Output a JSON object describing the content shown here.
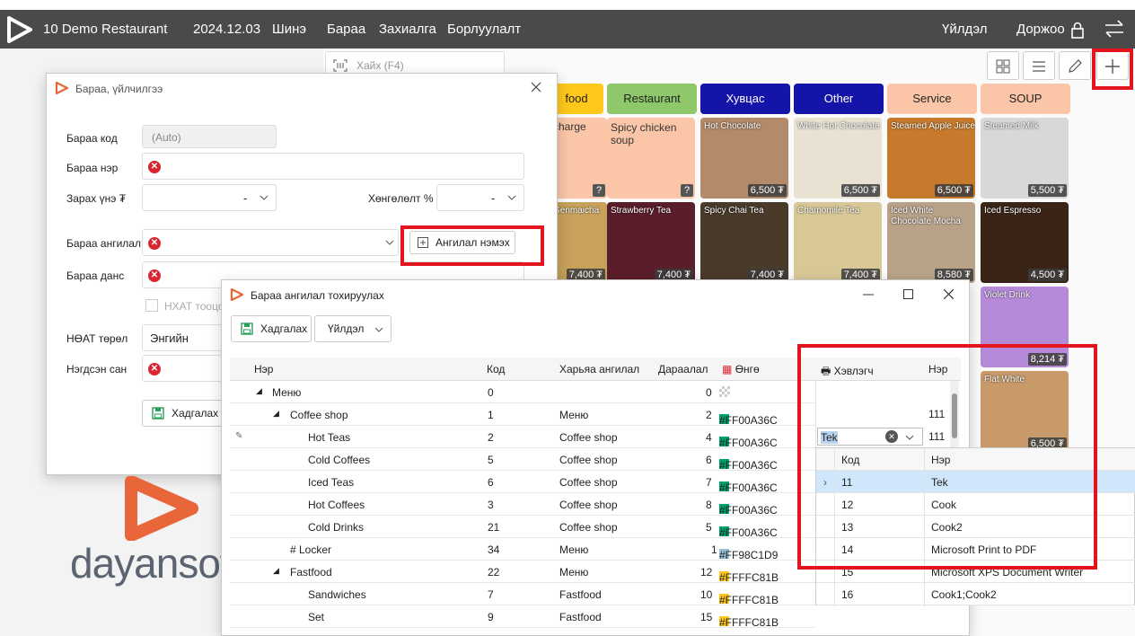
{
  "nav": {
    "restaurant": "10 Demo Restaurant",
    "date": "2024.12.03",
    "items": [
      "Шинэ",
      "Бараа",
      "Захиалга",
      "Борлуулалт"
    ],
    "action": "Үйлдэл",
    "user": "Доржоо"
  },
  "search": {
    "placeholder": "Хайх (F4)"
  },
  "categories": [
    {
      "label": "food",
      "color": "#FFC81B"
    },
    {
      "label": "Restaurant",
      "color": "#8FC86A"
    },
    {
      "label": "Хувцас",
      "color": "#1414A8"
    },
    {
      "label": "Other",
      "color": "#1414A8"
    },
    {
      "label": "Service",
      "color": "#FBC6A8"
    },
    {
      "label": "SOUP",
      "color": "#FBC6A8"
    }
  ],
  "tiles": [
    {
      "name": "charge",
      "price": "",
      "bg": "#FBC6A8"
    },
    {
      "name": "Spicy chicken soup",
      "price": "",
      "bg": "#FBC6A8"
    },
    {
      "name": "Hot Chocolate",
      "price": "6,500 ₮",
      "bg": "#b38a6a"
    },
    {
      "name": "White Hot Chocolate",
      "price": "6,500 ₮",
      "bg": "#e9e2d3"
    },
    {
      "name": "Steamed Apple Juice",
      "price": "6,500 ₮",
      "bg": "#c77a2b"
    },
    {
      "name": "Steamed Milk",
      "price": "5,500 ₮",
      "bg": "#e8e8e8"
    },
    {
      "name": "Genmaicha",
      "price": "7,400 ₮",
      "bg": "#c8a25a"
    },
    {
      "name": "Strawberry Tea",
      "price": "7,400 ₮",
      "bg": "#5a1d2a"
    },
    {
      "name": "Spicy Chai Tea",
      "price": "7,400 ₮",
      "bg": "#4a3a2a"
    },
    {
      "name": "Chamomile Tea",
      "price": "7,400 ₮",
      "bg": "#d8c898"
    },
    {
      "name": "Iced White Chocolate Mocha",
      "price": "8,580 ₮",
      "bg": "#d8c2a8"
    },
    {
      "name": "Iced Espresso",
      "price": "4,500 ₮",
      "bg": "#3a2418"
    },
    {
      "name": "Violet Drink",
      "price": "8,214 ₮",
      "bg": "#b58ad8"
    },
    {
      "name": "Flat White",
      "price": "6,500 ₮",
      "bg": "#c89a6a"
    }
  ],
  "win1": {
    "title": "Бараа, үйлчилгээ",
    "code_label": "Бараа код",
    "code_value": "(Auto)",
    "name_label": "Бараа нэр",
    "price_label": "Зарах үнэ ₮",
    "price_value": "-",
    "discount_label": "Хөнгөлөлт %",
    "discount_value": "-",
    "category_label": "Бараа ангилал",
    "add_category": "Ангилал нэмэх",
    "account_label": "Бараа данс",
    "vat_checkbox": "НХАТ тооцох",
    "vat_type_label": "НӨАТ төрөл",
    "vat_type_value": "Энгийн",
    "unit_label": "Нэгдсэн сан",
    "save": "Хадгалах"
  },
  "brand": "dayansoft",
  "win2": {
    "title": "Бараа ангилал тохируулах",
    "save": "Хадгалах",
    "action": "Үйлдэл",
    "columns": [
      "Нэр",
      "Код",
      "Харьяа ангилал",
      "Дараалал",
      "Өнгө",
      "Хэвлэгч",
      "Нэр"
    ],
    "rows": [
      {
        "name": "Меню",
        "code": "0",
        "parent": "",
        "order": "0",
        "color": "",
        "printer": "",
        "last": "",
        "indent": 0
      },
      {
        "name": "Coffee shop",
        "code": "1",
        "parent": "Меню",
        "order": "2",
        "color": "#FF00A36C",
        "printer": "",
        "last": "111",
        "indent": 1
      },
      {
        "name": "Hot Teas",
        "code": "2",
        "parent": "Coffee shop",
        "order": "4",
        "color": "#FF00A36C",
        "printer": "Tek",
        "last": "111",
        "indent": 2
      },
      {
        "name": "Cold Coffees",
        "code": "5",
        "parent": "Coffee shop",
        "order": "6",
        "color": "#FF00A36C",
        "printer": "",
        "last": "",
        "indent": 2
      },
      {
        "name": "Iced Teas",
        "code": "6",
        "parent": "Coffee shop",
        "order": "7",
        "color": "#FF00A36C",
        "printer": "",
        "last": "",
        "indent": 2
      },
      {
        "name": "Hot Coffees",
        "code": "3",
        "parent": "Coffee shop",
        "order": "8",
        "color": "#FF00A36C",
        "printer": "",
        "last": "",
        "indent": 2
      },
      {
        "name": "Cold Drinks",
        "code": "21",
        "parent": "Coffee shop",
        "order": "5",
        "color": "#FF00A36C",
        "printer": "",
        "last": "",
        "indent": 2
      },
      {
        "name": "# Locker",
        "code": "34",
        "parent": "Меню",
        "order": "1",
        "color": "#FF98C1D9",
        "printer": "",
        "last": "",
        "indent": 1
      },
      {
        "name": "Fastfood",
        "code": "22",
        "parent": "Меню",
        "order": "12",
        "color": "#FFFFC81B",
        "printer": "",
        "last": "",
        "indent": 1
      },
      {
        "name": "Sandwiches",
        "code": "7",
        "parent": "Fastfood",
        "order": "10",
        "color": "#FFFFC81B",
        "printer": "",
        "last": "",
        "indent": 2
      },
      {
        "name": "Set",
        "code": "9",
        "parent": "Fastfood",
        "order": "15",
        "color": "#FFFFC81B",
        "printer": "",
        "last": "",
        "indent": 2
      }
    ],
    "dropdown": {
      "headers": [
        "Код",
        "Нэр"
      ],
      "items": [
        {
          "code": "11",
          "name": "Tek"
        },
        {
          "code": "12",
          "name": "Cook"
        },
        {
          "code": "13",
          "name": "Cook2"
        },
        {
          "code": "14",
          "name": "Microsoft Print to PDF"
        },
        {
          "code": "15",
          "name": "Microsoft XPS Document Writer"
        },
        {
          "code": "16",
          "name": "Cook1;Cook2"
        }
      ]
    }
  }
}
